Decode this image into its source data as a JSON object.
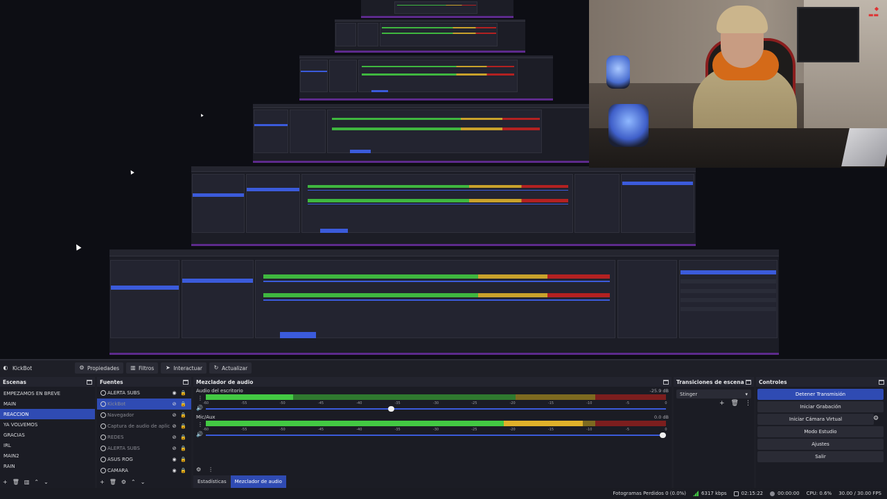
{
  "context_bar": {
    "source_name": "KickBot",
    "properties": "Propiedades",
    "filters": "Filtros",
    "interact": "Interactuar",
    "refresh": "Actualizar"
  },
  "scenes": {
    "title": "Escenas",
    "items": [
      "EMPEZAMOS EN BREVE",
      "MAIN",
      "REACCION",
      "YA VOLVEMOS",
      "GRACIAS",
      "IRL",
      "MAIN2",
      "RAIN"
    ],
    "selected_index": 2
  },
  "sources": {
    "title": "Fuentes",
    "items": [
      {
        "label": "ALERTA SUBS",
        "dim": false
      },
      {
        "label": "KickBot",
        "dim": true
      },
      {
        "label": "Navegador",
        "dim": true
      },
      {
        "label": "Captura de audio de aplicació",
        "dim": true
      },
      {
        "label": "REDES",
        "dim": true
      },
      {
        "label": "ALERTA SUBS",
        "dim": true
      },
      {
        "label": "ASUS ROG",
        "dim": false
      },
      {
        "label": "CAMARA",
        "dim": false
      }
    ],
    "selected_index": 1
  },
  "mixer": {
    "title": "Mezclador de audio",
    "ticks": [
      "-60",
      "-55",
      "-50",
      "-45",
      "-40",
      "-35",
      "-30",
      "-25",
      "-20",
      "-15",
      "-10",
      "-5",
      "0"
    ],
    "channels": [
      {
        "name": "Audio del escritorio",
        "db": "-25.9 dB",
        "level": 0.19,
        "volume": 0.41
      },
      {
        "name": "Mic/Aux",
        "db": "0.0 dB",
        "level": 0.82,
        "volume": 1.0
      }
    ],
    "tab_stats": "Estadísticas",
    "tab_mixer": "Mezclador de audio"
  },
  "transitions": {
    "title": "Transiciones de escena",
    "selected": "Stinger"
  },
  "controls": {
    "title": "Controles",
    "start_stop_stream": "Detener Transmisión",
    "start_recording": "Iniciar Grabación",
    "virtual_camera": "Iniciar Cámara Virtual",
    "studio_mode": "Modo Estudio",
    "settings": "Ajustes",
    "exit": "Salir"
  },
  "status": {
    "dropped_frames": "Fotogramas Perdidos 0 (0.0%)",
    "bitrate": "6317 kbps",
    "time": "02:15:22",
    "rec_time": "00:00:00",
    "cpu": "CPU: 0.6%",
    "fps": "30.00 / 30.00 FPS"
  },
  "colors": {
    "accent": "#2f4bb3",
    "meter_green": "#43c943",
    "meter_yellow": "#e0b12a",
    "meter_red": "#b32121"
  }
}
